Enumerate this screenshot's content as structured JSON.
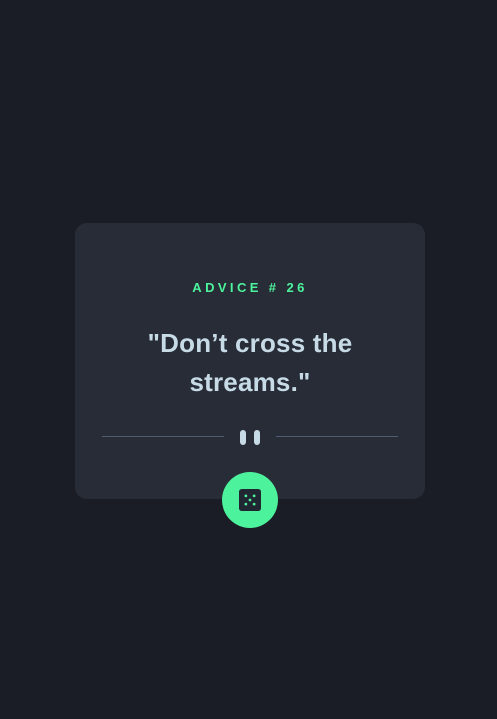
{
  "card": {
    "advice_label": "ADVICE # 26",
    "advice_text": "\"Don’t cross the streams.\""
  },
  "icons": {
    "divider": "pause-icon",
    "button": "dice-icon"
  },
  "colors": {
    "background": "#1a1d25",
    "card": "#272c37",
    "accent": "#4df39c",
    "text": "#c7dbe7",
    "divider": "#4e5d73"
  }
}
